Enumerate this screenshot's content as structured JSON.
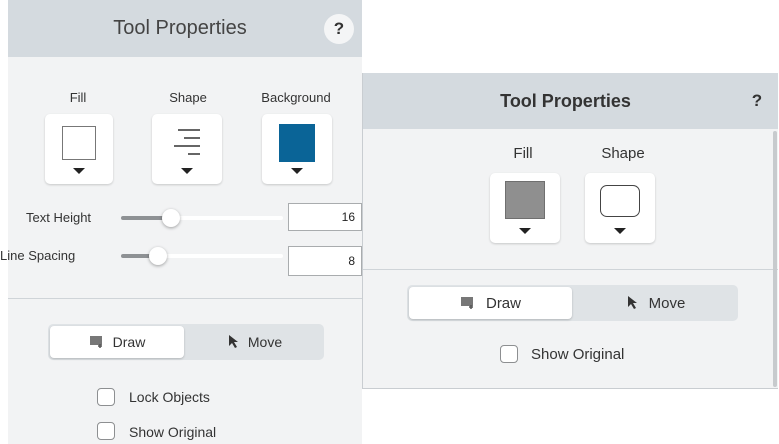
{
  "left_panel": {
    "title": "Tool Properties",
    "help_label": "?",
    "properties": [
      {
        "label": "Fill",
        "icon": "empty-fill-swatch-icon"
      },
      {
        "label": "Shape",
        "icon": "align-lines-icon"
      },
      {
        "label": "Background",
        "icon": "blue-background-swatch-icon",
        "color": "#0a6497"
      }
    ],
    "sliders": [
      {
        "label": "Text Height",
        "value": "16",
        "level": 0.3
      },
      {
        "label": "Line Spacing",
        "value": "8",
        "level": 0.2
      }
    ],
    "mode": {
      "draw_label": "Draw",
      "move_label": "Move",
      "active": "draw"
    },
    "checkboxes": [
      {
        "label": "Lock Objects",
        "checked": false
      },
      {
        "label": "Show Original",
        "checked": false
      }
    ]
  },
  "right_panel": {
    "title": "Tool Properties",
    "help_label": "?",
    "properties": [
      {
        "label": "Fill",
        "icon": "gray-fill-swatch-icon",
        "color": "#8f8f8f"
      },
      {
        "label": "Shape",
        "icon": "rounded-rectangle-icon"
      }
    ],
    "mode": {
      "draw_label": "Draw",
      "move_label": "Move",
      "active": "draw"
    },
    "checkboxes": [
      {
        "label": "Show Original",
        "checked": false
      }
    ]
  }
}
